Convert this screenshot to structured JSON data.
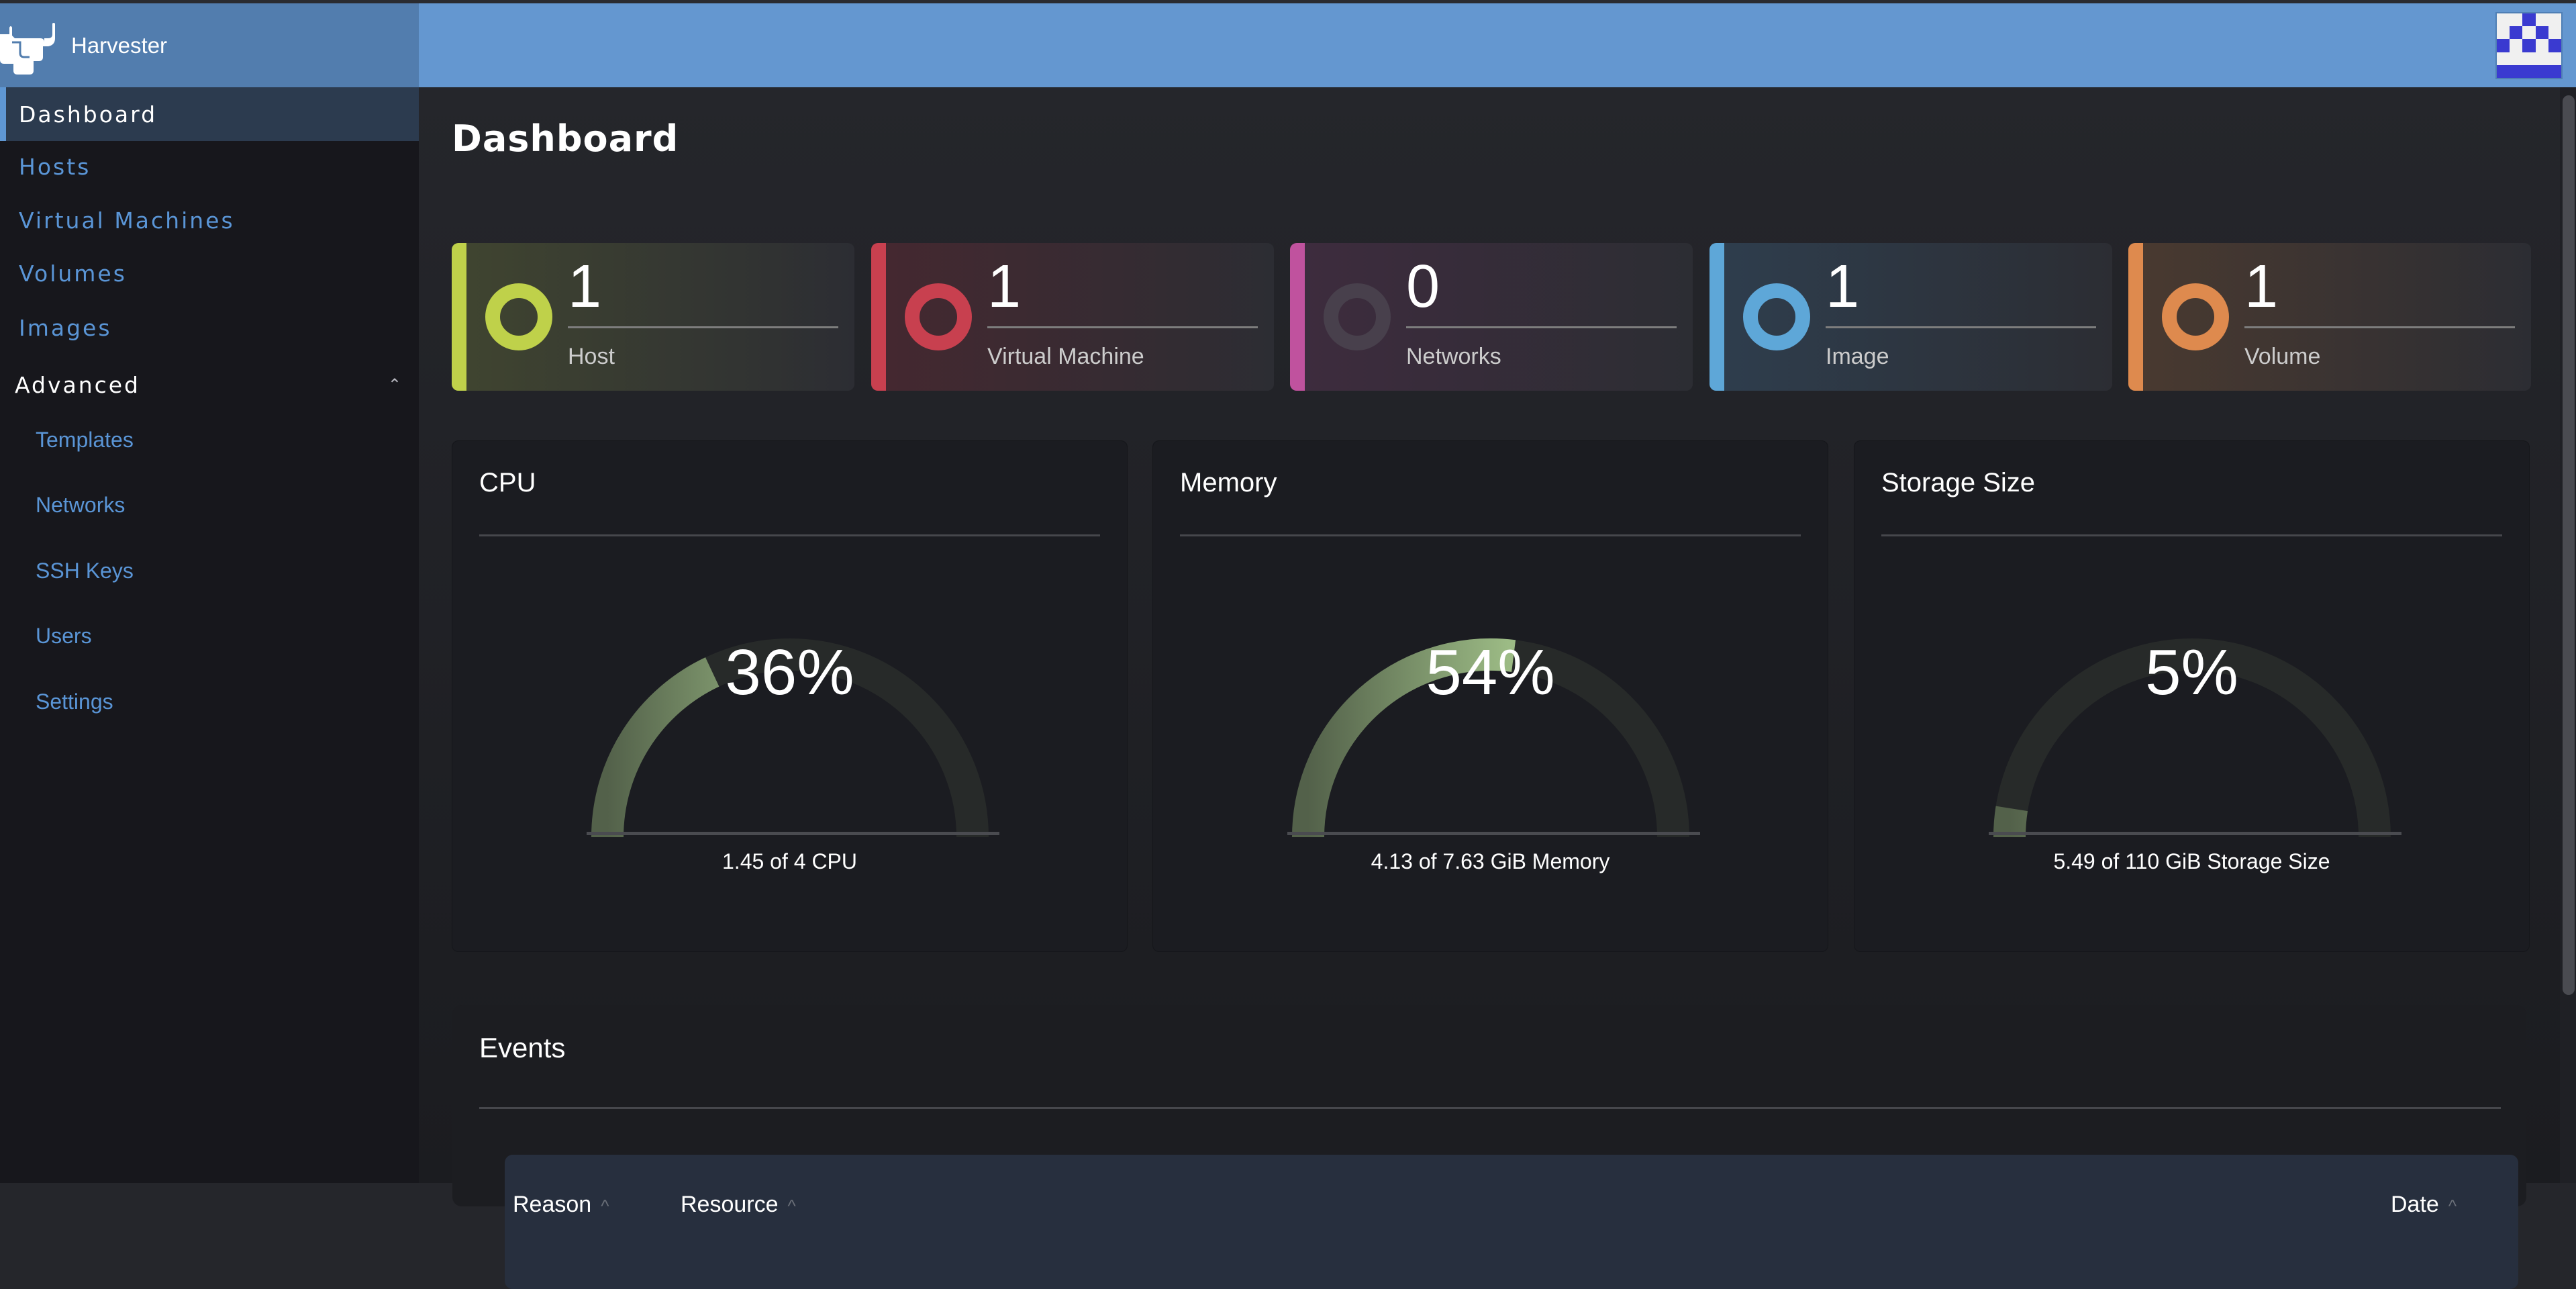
{
  "app": {
    "title": "Harvester",
    "logo_icon": "harvester-bull-logo-icon"
  },
  "header": {
    "avatar_icon": "identicon-avatar-icon",
    "avatar_pattern": [
      [
        0,
        0,
        1,
        0,
        0
      ],
      [
        0,
        1,
        0,
        1,
        0
      ],
      [
        1,
        0,
        1,
        0,
        1
      ],
      [
        0,
        0,
        0,
        0,
        0
      ],
      [
        1,
        1,
        1,
        1,
        1
      ]
    ],
    "avatar_color": "#3a3ad0"
  },
  "sidebar": {
    "items": [
      {
        "label": "Dashboard",
        "active": true
      },
      {
        "label": "Hosts"
      },
      {
        "label": "Virtual Machines"
      },
      {
        "label": "Volumes"
      },
      {
        "label": "Images"
      }
    ],
    "group": {
      "label": "Advanced",
      "expanded": true,
      "chevron_icon": "chevron-up-icon",
      "items": [
        {
          "label": "Templates"
        },
        {
          "label": "Networks"
        },
        {
          "label": "SSH Keys"
        },
        {
          "label": "Users"
        },
        {
          "label": "Settings"
        }
      ]
    }
  },
  "main": {
    "page_title": "Dashboard",
    "summary_cards": [
      {
        "count": "1",
        "label": "Host",
        "color": "#bfd14a",
        "bg": "#404530",
        "ring": "#bfd14a"
      },
      {
        "count": "1",
        "label": "Virtual Machine",
        "color": "#c8404f",
        "bg": "#452830",
        "ring": "#c8404f"
      },
      {
        "count": "0",
        "label": "Networks",
        "color": "#c0529e",
        "bg": "#3e2c3e",
        "ring": "#48404c"
      },
      {
        "count": "1",
        "label": "Image",
        "color": "#5ea7d8",
        "bg": "#2e3e4e",
        "ring": "#5ea7d8"
      },
      {
        "count": "1",
        "label": "Volume",
        "color": "#de8a4e",
        "bg": "#4a3a30",
        "ring": "#de8a4e"
      }
    ],
    "gauges": [
      {
        "title": "CPU",
        "percent_label": "36%",
        "value": 0.36,
        "detail": "1.45 of 4 CPU"
      },
      {
        "title": "Memory",
        "percent_label": "54%",
        "value": 0.54,
        "detail": "4.13 of 7.63 GiB Memory"
      },
      {
        "title": "Storage Size",
        "percent_label": "5%",
        "value": 0.05,
        "detail": "5.49 of 110 GiB Storage Size"
      }
    ],
    "events": {
      "title": "Events",
      "columns": [
        {
          "label": "Reason",
          "sort_icon": "sort-up-icon"
        },
        {
          "label": "Resource",
          "sort_icon": "sort-up-icon"
        },
        {
          "label": "Date",
          "sort_icon": "sort-up-icon"
        }
      ],
      "sort_glyph": "^"
    }
  },
  "colors": {
    "header": "#6497d0",
    "brand": "#527dae",
    "nav_link": "#5a95d6",
    "gauge_fill_start": "#53614a",
    "gauge_fill_end": "#9cbb85",
    "gauge_track": "#272a29"
  }
}
